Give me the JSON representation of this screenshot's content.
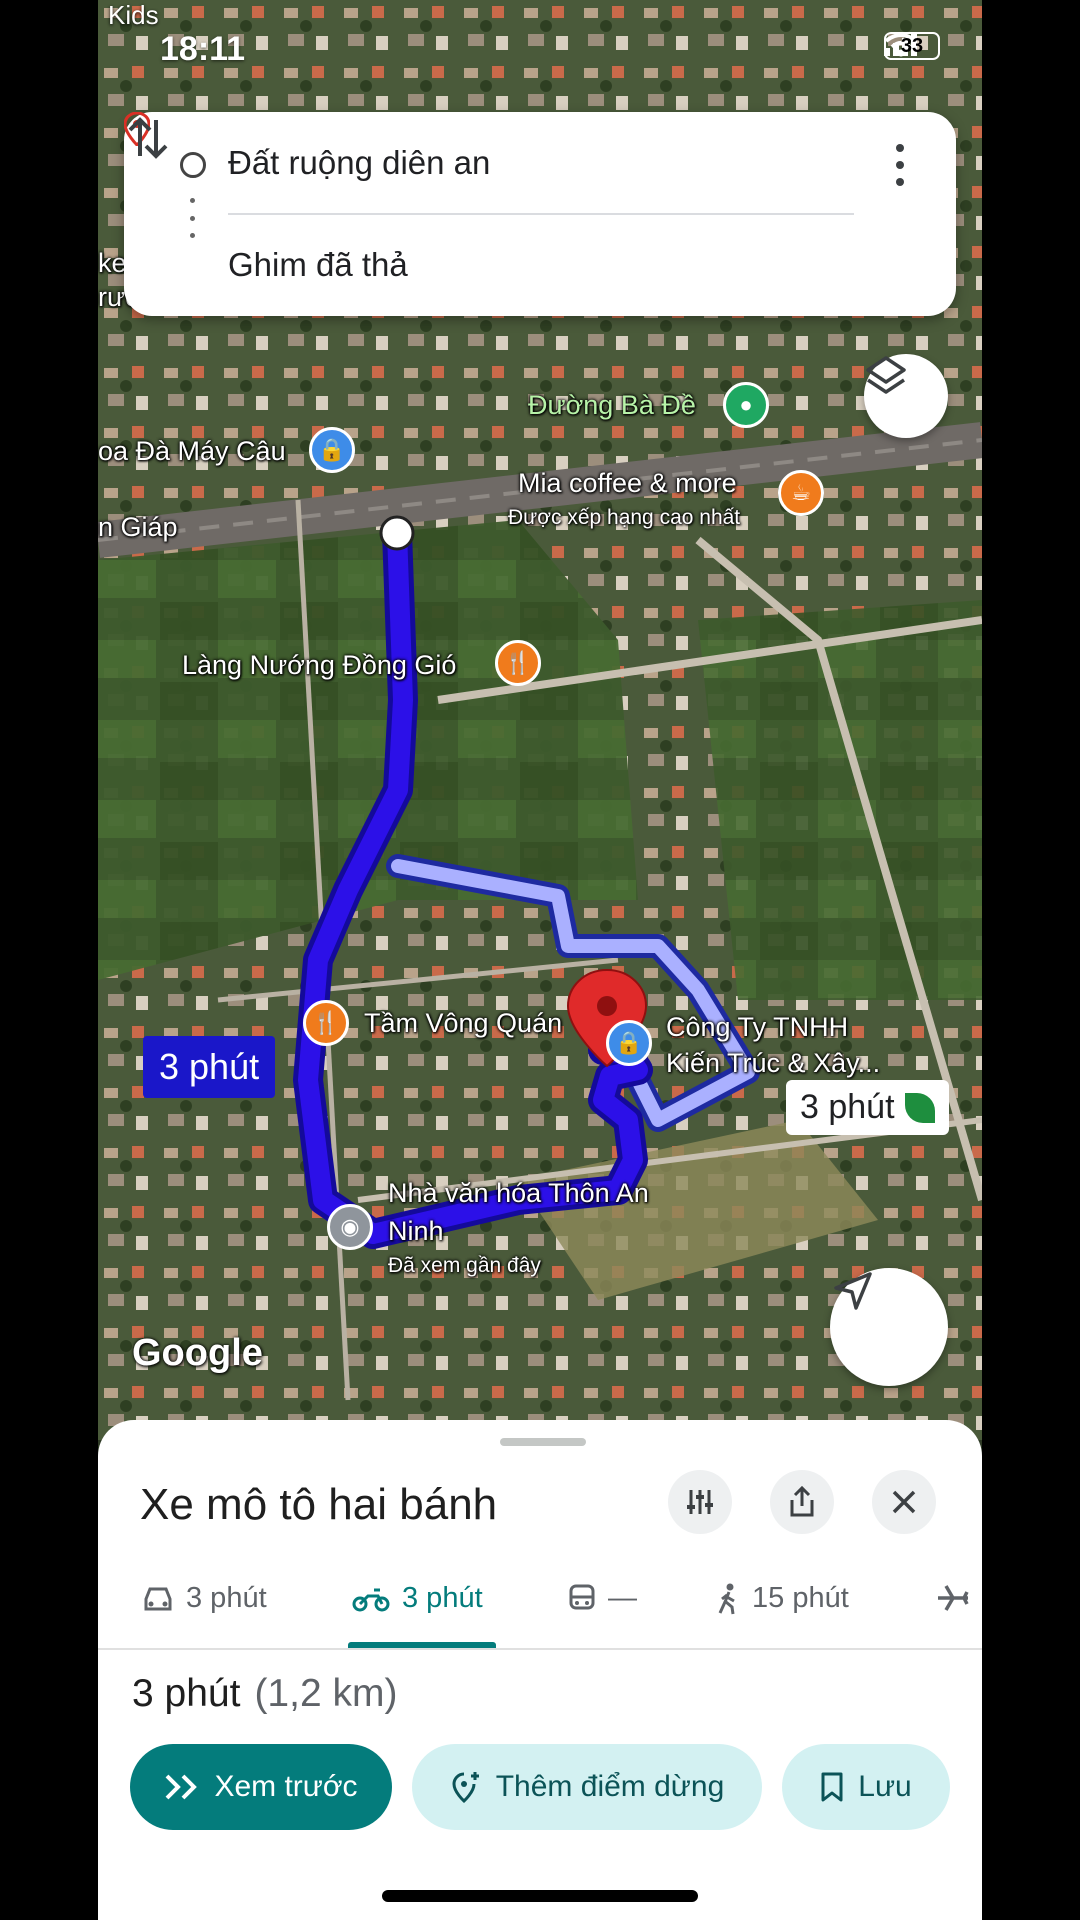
{
  "status_bar": {
    "time": "18:11",
    "battery": "33",
    "top_label": "Kids"
  },
  "directions": {
    "from": "Đất ruộng diên an",
    "to": "Ghim đã thả"
  },
  "map_labels": {
    "duong_ba_de": "Đường Bà Đề",
    "may_cau": "oa Đà Máy Câu",
    "giap": "n Giáp",
    "mia_coffee": "Mia coffee & more",
    "mia_rating": "Được xếp hạng cao nhất",
    "lang_nuong": "Làng Nướng Đồng Gió",
    "tam_vong": "Tầm Vông Quán",
    "cong_ty_1": "Công Ty TNHH",
    "cong_ty_2": "Kiến Trúc & Xây...",
    "nha_van_hoa_1": "Nhà văn hóa Thôn An",
    "nha_van_hoa_2": "Ninh",
    "recent": "Đã xem gần đây",
    "left_edge_1": "ke",
    "left_edge_2": "rườ",
    "google": "Google"
  },
  "route_chips": {
    "primary": "3 phút",
    "alternate": "3 phút"
  },
  "sheet": {
    "title": "Xe mô tô hai bánh",
    "modes": [
      {
        "icon": "car-icon",
        "label": "3 phút"
      },
      {
        "icon": "motorbike-icon",
        "label": "3 phút"
      },
      {
        "icon": "transit-icon",
        "label": "—"
      },
      {
        "icon": "walk-icon",
        "label": "15 phút"
      }
    ],
    "summary_time": "3 phút",
    "summary_distance": "(1,2 km)",
    "buttons": {
      "preview": "Xem trước",
      "add_stop": "Thêm điểm dừng",
      "save": "Lưu"
    }
  },
  "colors": {
    "route": "#2c10e8",
    "route_alt": "#aab0ff",
    "accent": "#047c7c",
    "pill_secondary": "#d3f1f2"
  }
}
